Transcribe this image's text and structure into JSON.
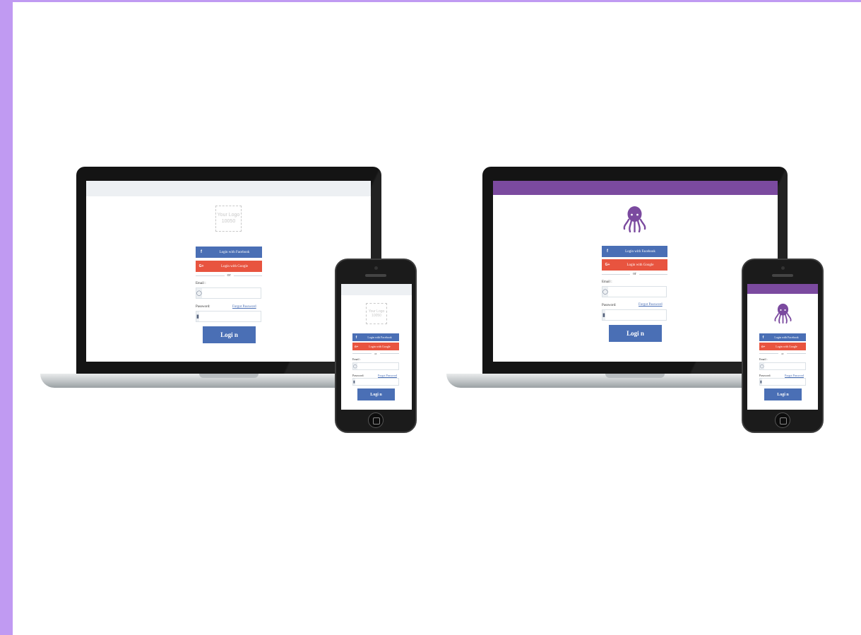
{
  "colors": {
    "facebook": "#4a6fb5",
    "google": "#e8543f",
    "login_button": "#4a6fb5",
    "purple_theme": "#7b4a9f",
    "gray_theme": "#edf0f3",
    "background_frame": "#c09af2"
  },
  "login": {
    "logo_placeholder": [
      "Your Logo",
      "10050"
    ],
    "facebook_icon": "f",
    "facebook_label": "Login with Facebook",
    "google_icon": "G+",
    "google_label": "Login with Google",
    "or": "or",
    "email_label": "Email :",
    "email_icon": "user-icon",
    "password_label": "Password:",
    "password_icon": "lock-icon",
    "forgot_password": "Forgot Password",
    "login_button": "Logi n",
    "octopus_logo_icon": "octopus-icon"
  }
}
